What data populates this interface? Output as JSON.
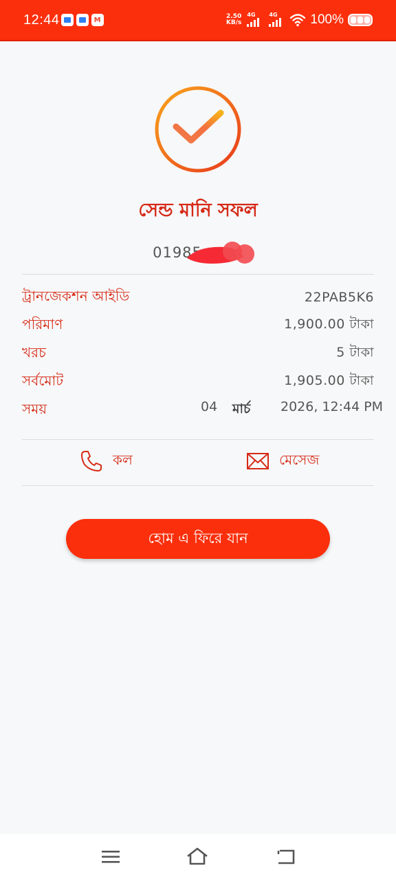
{
  "status_bar": {
    "time": "12:44",
    "net_speed_value": "2.50",
    "net_speed_unit": "KB/s",
    "sim1_label": "4G",
    "sim2_label": "4G",
    "battery_percent": "100%",
    "notification_icons": [
      "app-notification-icon",
      "message-notification-icon",
      "gmail-icon"
    ]
  },
  "result": {
    "icon": "checkmark-circle-icon",
    "title": "সেন্ড মানি সফল",
    "phone_prefix": "01985"
  },
  "details": [
    {
      "label": "ট্রানজেকশন আইডি",
      "value": "22PAB5K6"
    },
    {
      "label": "পরিমাণ",
      "value": "1,900.00  টাকা"
    },
    {
      "label": "খরচ",
      "value": "5 টাকা"
    },
    {
      "label": "সর্বমোট",
      "value": "1,905.00  টাকা"
    }
  ],
  "time_row": {
    "label": "সময়",
    "day": "04",
    "month": "মার্চ",
    "rest": "2026, 12:44 PM"
  },
  "actions": {
    "call_label": "কল",
    "message_label": "মেসেজ"
  },
  "home_button_label": "হোম এ ফিরে যান",
  "colors": {
    "accent": "#fb2f0c",
    "label_red": "#d62a17",
    "gradient_start": "#f7a21b",
    "gradient_end": "#e8391c"
  }
}
